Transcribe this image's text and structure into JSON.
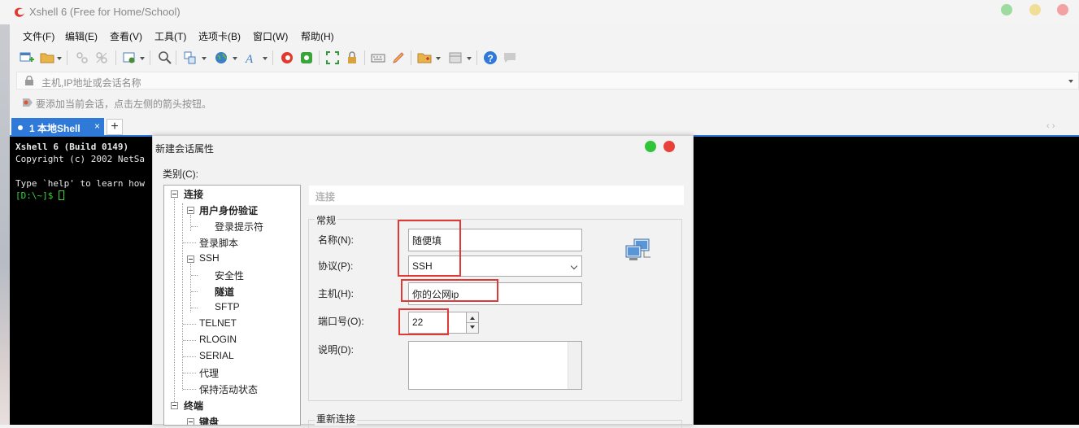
{
  "window": {
    "title": "Xshell 6 (Free for Home/School)",
    "controls_colors": [
      "#9edb9e",
      "#f1de96",
      "#f2a2a2"
    ]
  },
  "menu": [
    "文件(F)",
    "编辑(E)",
    "查看(V)",
    "工具(T)",
    "选项卡(B)",
    "窗口(W)",
    "帮助(H)"
  ],
  "address": {
    "placeholder": "主机,IP地址或会话名称"
  },
  "hint": "要添加当前会话，点击左侧的箭头按钮。",
  "tabs": [
    {
      "label": "1 本地Shell",
      "close": "×"
    }
  ],
  "tab_add": "+",
  "tab_nav": "‹ ›",
  "terminal": {
    "lines": [
      "Xshell 6 (Build 0149)",
      "Copyright (c) 2002 NetSa",
      "",
      "Type `help' to learn how"
    ],
    "prompt": "[D:\\~]$ "
  },
  "dialog": {
    "title": "新建会话属性",
    "category_label": "类别(C):",
    "tree": [
      {
        "label": "连接",
        "bold": true,
        "level": 0,
        "expander": true
      },
      {
        "label": "用户身份验证",
        "bold": true,
        "level": 1,
        "expander": true
      },
      {
        "label": "登录提示符",
        "bold": false,
        "level": 2,
        "expander": false
      },
      {
        "label": "登录脚本",
        "bold": false,
        "level": 1,
        "expander": false
      },
      {
        "label": "SSH",
        "bold": false,
        "level": 1,
        "expander": true
      },
      {
        "label": "安全性",
        "bold": false,
        "level": 2,
        "expander": false
      },
      {
        "label": "隧道",
        "bold": true,
        "level": 2,
        "expander": false
      },
      {
        "label": "SFTP",
        "bold": false,
        "level": 2,
        "expander": false
      },
      {
        "label": "TELNET",
        "bold": false,
        "level": 1,
        "expander": false
      },
      {
        "label": "RLOGIN",
        "bold": false,
        "level": 1,
        "expander": false
      },
      {
        "label": "SERIAL",
        "bold": false,
        "level": 1,
        "expander": false
      },
      {
        "label": "代理",
        "bold": false,
        "level": 1,
        "expander": false
      },
      {
        "label": "保持活动状态",
        "bold": false,
        "level": 1,
        "expander": false
      },
      {
        "label": "终端",
        "bold": true,
        "level": 0,
        "expander": true
      },
      {
        "label": "键盘",
        "bold": true,
        "level": 1,
        "expander": true
      }
    ],
    "panel_header": "连接",
    "group_general": "常规",
    "fields": {
      "name_label": "名称(N):",
      "name_value": "随便填",
      "protocol_label": "协议(P):",
      "protocol_value": "SSH",
      "host_label": "主机(H):",
      "host_value": "你的公网ip",
      "port_label": "端口号(O):",
      "port_value": "22",
      "desc_label": "说明(D):",
      "desc_value": ""
    },
    "group_reconnect": "重新连接"
  }
}
